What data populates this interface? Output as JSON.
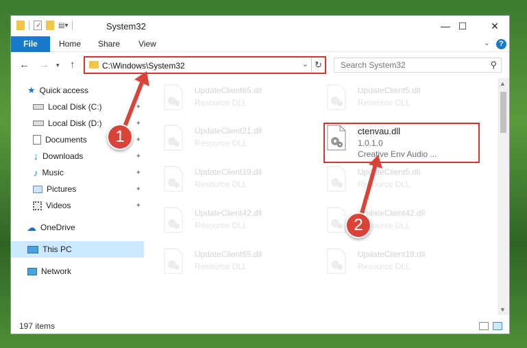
{
  "window": {
    "title": "System32",
    "controls": {
      "minimize": "—",
      "maximize": "☐",
      "close": "✕"
    }
  },
  "ribbon": {
    "tabs": [
      {
        "label": "File"
      },
      {
        "label": "Home"
      },
      {
        "label": "Share"
      },
      {
        "label": "View"
      }
    ],
    "help": "?"
  },
  "nav": {
    "address_path": "C:\\Windows\\System32",
    "search_placeholder": "Search System32"
  },
  "sidebar": {
    "items": [
      {
        "label": "Quick access",
        "icon": "star-icon",
        "pinned": false
      },
      {
        "label": "Local Disk (C:)",
        "icon": "drive-icon",
        "pinned": true
      },
      {
        "label": "Local Disk (D:)",
        "icon": "drive-icon",
        "pinned": true
      },
      {
        "label": "Documents",
        "icon": "documents-icon",
        "pinned": true
      },
      {
        "label": "Downloads",
        "icon": "downloads-icon",
        "pinned": true
      },
      {
        "label": "Music",
        "icon": "music-icon",
        "pinned": true
      },
      {
        "label": "Pictures",
        "icon": "pictures-icon",
        "pinned": true
      },
      {
        "label": "Videos",
        "icon": "videos-icon",
        "pinned": true
      },
      {
        "label": "OneDrive",
        "icon": "cloud-icon",
        "pinned": false
      },
      {
        "label": "This PC",
        "icon": "computer-icon",
        "pinned": false,
        "selected": true
      },
      {
        "label": "Network",
        "icon": "network-icon",
        "pinned": false
      }
    ]
  },
  "files": [
    {
      "name": "UpdateClient65.dll",
      "desc": "Resource DLL"
    },
    {
      "name": "UpdateClient5.dll",
      "desc": "Resource DLL"
    },
    {
      "name": "UpdateClient21.dll",
      "desc": "Resource DLL"
    },
    {
      "name": "ctenvau.dll",
      "desc": "1.0.1.0",
      "desc2": "Creative Env Audio ...",
      "highlighted": true
    },
    {
      "name": "UpdateClient19.dll",
      "desc": "Resource DLL"
    },
    {
      "name": "UpdateClient5.dll",
      "desc": "Resource DLL"
    },
    {
      "name": "UpdateClient42.dll",
      "desc": "Resource DLL"
    },
    {
      "name": "UpdateClient42.dll",
      "desc": "Resource DLL"
    },
    {
      "name": "UpdateClient65.dll",
      "desc": "Resource DLL"
    },
    {
      "name": "UpdateClient19.dll",
      "desc": "Resource DLL"
    }
  ],
  "status": {
    "item_count": "197 items"
  },
  "annotations": {
    "step1": "1",
    "step2": "2"
  },
  "colors": {
    "accent": "#1979ca",
    "highlight": "#d0342c",
    "selected": "#cce8ff"
  }
}
